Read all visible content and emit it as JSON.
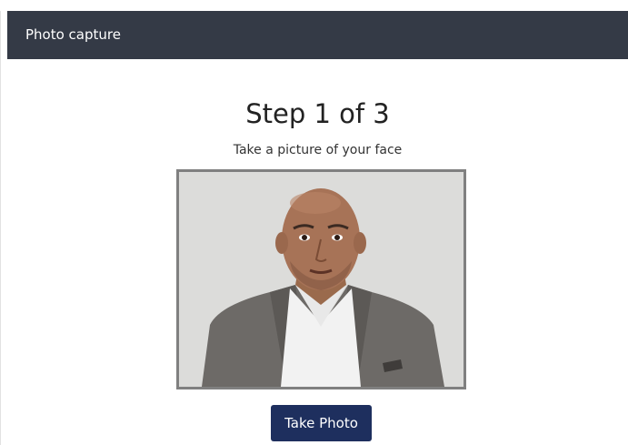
{
  "window": {
    "title": "Photo capture"
  },
  "step": {
    "title": "Step 1 of 3",
    "instruction": "Take a picture of your face"
  },
  "photo": {
    "subject": "portrait-of-man",
    "background_color": "#dcdcda",
    "border_color": "#808080"
  },
  "actions": {
    "take_photo_label": "Take Photo",
    "take_photo_color": "#1e2f5e"
  },
  "colors": {
    "titlebar": "#343a46"
  }
}
